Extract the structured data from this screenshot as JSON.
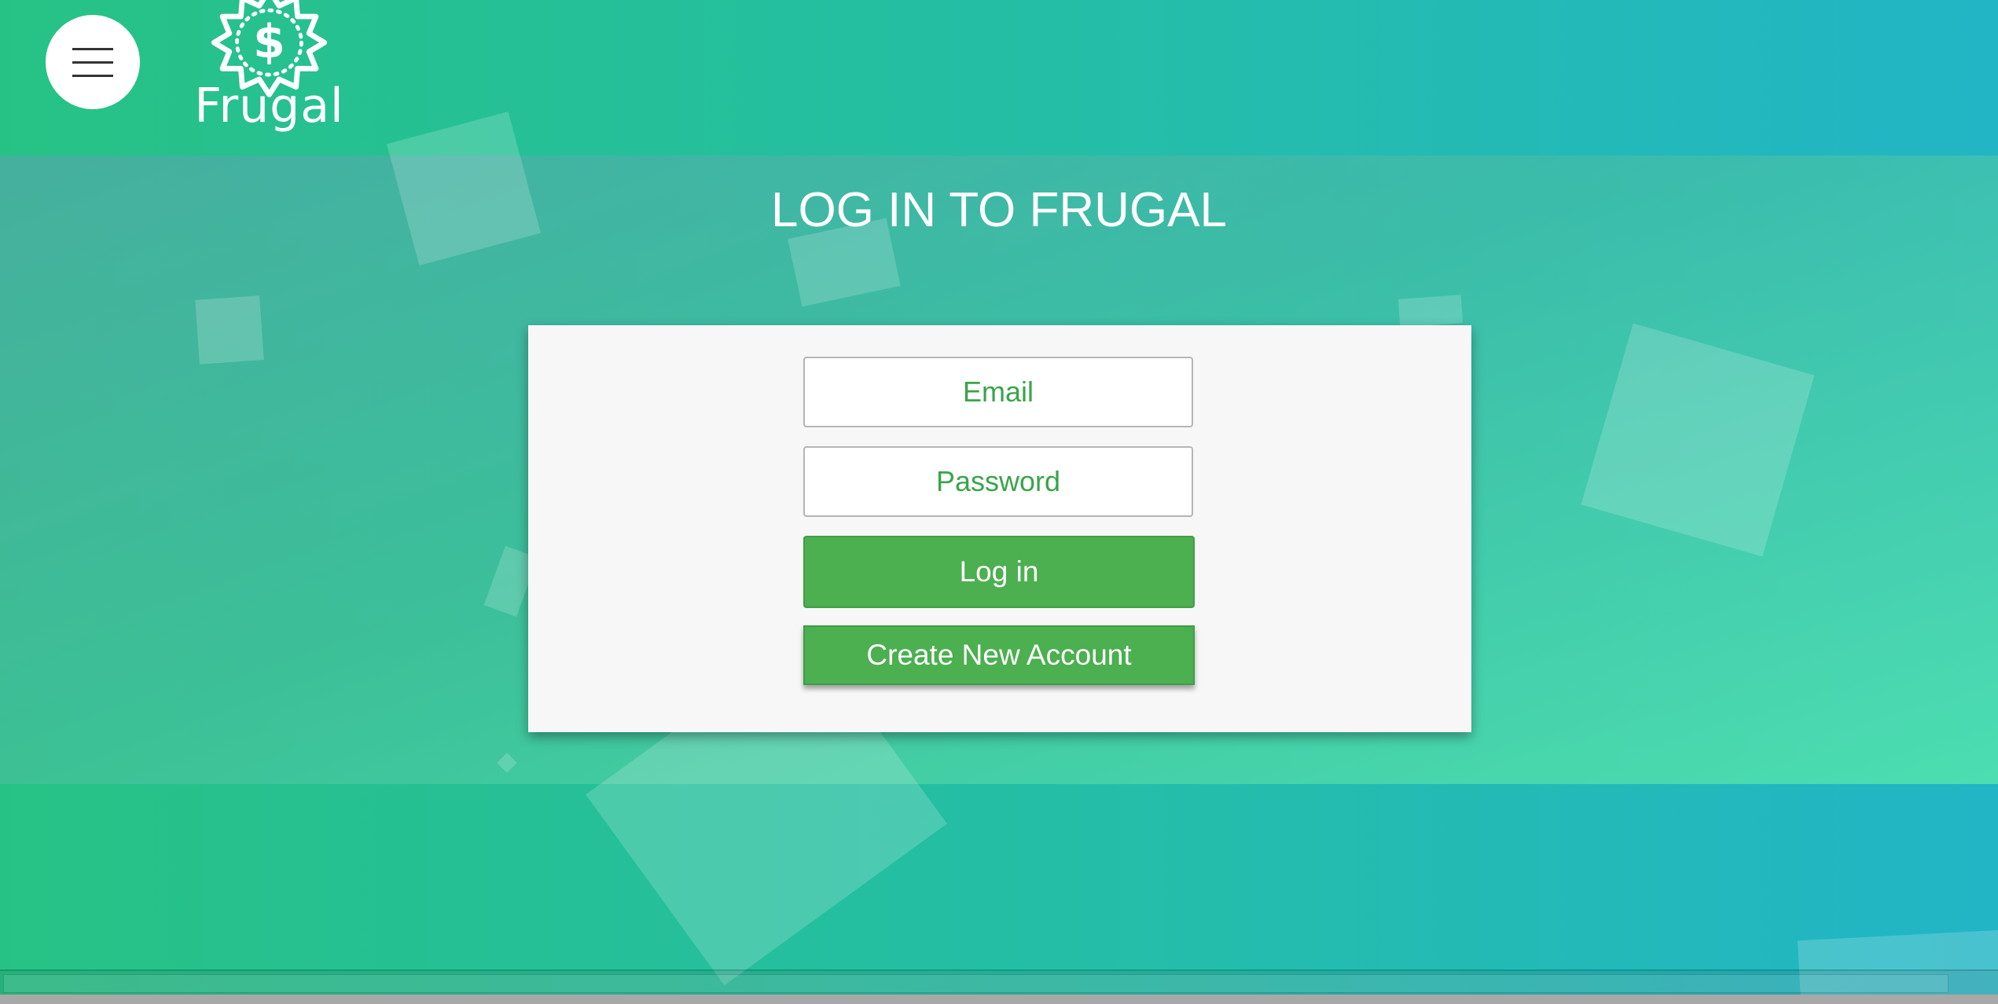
{
  "header": {
    "menu_icon": "hamburger-menu-icon",
    "logo_icon": "dollar-badge-icon",
    "logo_text": "Frugal"
  },
  "main": {
    "title": "LOG IN TO FRUGAL",
    "form": {
      "email_placeholder": "Email",
      "password_placeholder": "Password",
      "login_label": "Log in",
      "create_account_label": "Create New Account"
    }
  },
  "colors": {
    "primary_green": "#4caf50",
    "placeholder_green": "#3aa44a",
    "background_left": "#26c285",
    "background_right": "#22b5c6"
  }
}
